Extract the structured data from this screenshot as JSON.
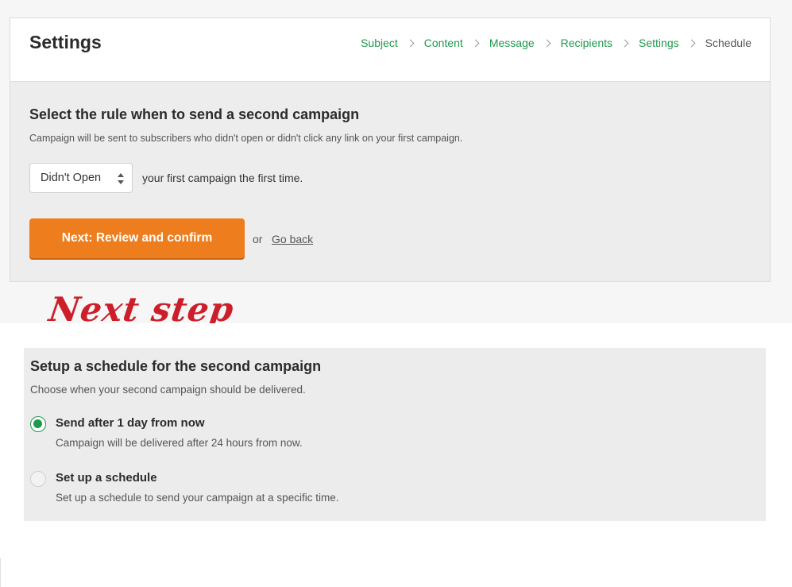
{
  "header": {
    "title": "Settings",
    "breadcrumb": [
      "Subject",
      "Content",
      "Message",
      "Recipients",
      "Settings",
      "Schedule"
    ]
  },
  "rule_section": {
    "title": "Select the rule when to send a second campaign",
    "description": "Campaign will be sent to subscribers who didn't open or didn't click any link on your first campaign.",
    "select_value": "Didn't Open",
    "select_suffix": "your first campaign the first time.",
    "next_button": "Next: Review and confirm",
    "or_text": "or",
    "go_back": "Go back"
  },
  "annotation": "Next step",
  "schedule_section": {
    "title": "Setup a schedule for the second campaign",
    "description": "Choose when your second campaign should be delivered.",
    "options": [
      {
        "label": "Send after 1 day from now",
        "sub": "Campaign will be delivered after 24 hours from now.",
        "checked": true
      },
      {
        "label": "Set up a schedule",
        "sub": "Set up a schedule to send your campaign at a specific time.",
        "checked": false
      }
    ]
  },
  "colors": {
    "accent_green": "#1f9a4c",
    "button_orange": "#ee7d1d",
    "annotation_red": "#cc1f2a"
  }
}
